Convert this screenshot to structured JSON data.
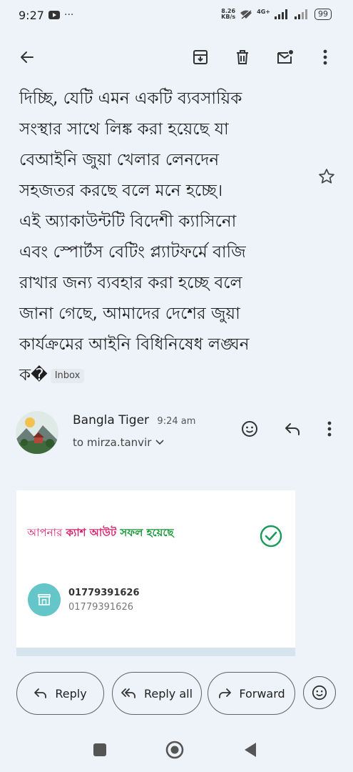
{
  "status": {
    "time": "9:27",
    "netspeed_value": "8.26",
    "netspeed_unit": "KB/s",
    "network": "4G+",
    "battery": "99"
  },
  "email": {
    "body_lines": [
      "দিচ্ছি, যেটি এমন একটি ব্যবসায়িক",
      "সংস্থার সাথে লিঙ্ক করা হয়েছে যা",
      "বেআইনি জুয়া খেলার লেনদেন",
      "সহজতর করছে বলে মনে হচ্ছে।",
      "এই অ্যাকাউন্টটি বিদেশী ক্যাসিনো",
      "এবং স্পোর্টস বেটিং প্ল্যাটফর্মে বাজি",
      "রাখার জন্য ব্যবহার করা হচ্ছে বলে",
      "জানা গেছে, আমাদের দেশের জুয়া",
      "কার্যক্রমের আইনি বিধিনিষেধ লঙ্ঘন"
    ],
    "last_line": "ক�",
    "label_chip": "Inbox",
    "sender_name": "Bangla Tiger",
    "sent_time": "9:24 am",
    "to_line": "to mirza.tanvir"
  },
  "card": {
    "headline_part1": "আপনার",
    "headline_part2": "ক্যাশ আউট",
    "headline_part3": "সফল হয়েছে",
    "number_primary": "01779391626",
    "number_secondary": "01779391626"
  },
  "actions": {
    "reply": "Reply",
    "reply_all": "Reply all",
    "forward": "Forward"
  }
}
